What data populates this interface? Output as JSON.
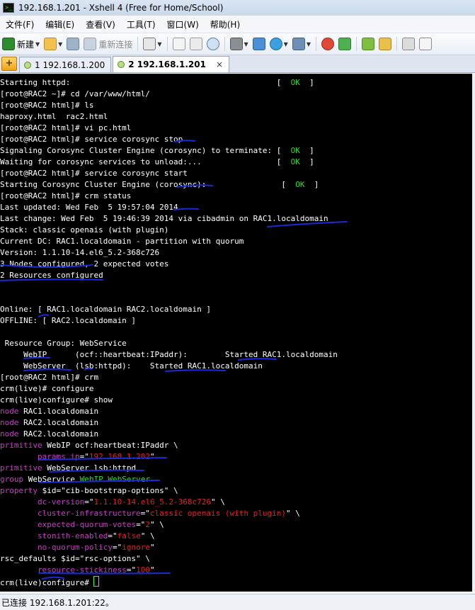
{
  "window": {
    "title": "192.168.1.201 - Xshell 4 (Free for Home/School)",
    "app_icon": "xshell-terminal-icon"
  },
  "menu": [
    "文件(F)",
    "编辑(E)",
    "查看(V)",
    "工具(T)",
    "窗口(W)",
    "帮助(H)"
  ],
  "toolbar": {
    "new_label": "新建",
    "reconnect_label": "重新连接",
    "icons": [
      "new-session-icon",
      "open-folder-icon",
      "link-icon",
      "reconnect-icon",
      "properties-icon",
      "copy-icon",
      "paste-icon",
      "find-icon",
      "print-icon",
      "transfer-icon",
      "globe-icon",
      "font-icon",
      "xftp-icon",
      "xagent-icon",
      "layout-icon",
      "lock-icon",
      "keyboard-icon",
      "chat-icon"
    ]
  },
  "tabs": [
    {
      "label": "1 192.168.1.200",
      "active": false
    },
    {
      "label": "2 192.168.1.201",
      "active": true
    }
  ],
  "terminal_lines": [
    [
      {
        "t": "Starting httpd:                                            [  "
      },
      {
        "t": "OK",
        "c": "green"
      },
      {
        "t": "  ]"
      }
    ],
    [
      {
        "t": "[root@RAC2 ~]# cd /var/www/html/"
      }
    ],
    [
      {
        "t": "[root@RAC2 html]# ls"
      }
    ],
    [
      {
        "t": "haproxy.html  rac2.html"
      }
    ],
    [
      {
        "t": "[root@RAC2 html]# vi pc.html"
      }
    ],
    [
      {
        "t": "[root@RAC2 html]# service corosync stop"
      }
    ],
    [
      {
        "t": "Signaling Corosync Cluster Engine (corosync) to terminate: [  "
      },
      {
        "t": "OK",
        "c": "green"
      },
      {
        "t": "  ]"
      }
    ],
    [
      {
        "t": "Waiting for corosync services to unload:...                [  "
      },
      {
        "t": "OK",
        "c": "green"
      },
      {
        "t": "  ]"
      }
    ],
    [
      {
        "t": "[root@RAC2 html]# service corosync start"
      }
    ],
    [
      {
        "t": "Starting Corosync Cluster Engine (corosync):                [  "
      },
      {
        "t": "OK",
        "c": "green"
      },
      {
        "t": "  ]"
      }
    ],
    [
      {
        "t": "[root@RAC2 html]# crm status"
      }
    ],
    [
      {
        "t": "Last updated: Wed Feb  5 19:57:04 2014"
      }
    ],
    [
      {
        "t": "Last change: Wed Feb  5 19:46:39 2014 via cibadmin on RAC1.localdomain"
      }
    ],
    [
      {
        "t": "Stack: classic openais (with plugin)"
      }
    ],
    [
      {
        "t": "Current DC: RAC1.localdomain - partition with quorum"
      }
    ],
    [
      {
        "t": "Version: 1.1.10-14.el6_5.2-368c726"
      }
    ],
    [
      {
        "t": "3 Nodes configured, 2 expected votes"
      }
    ],
    [
      {
        "t": "2 Resources configured"
      }
    ],
    [
      {
        "t": ""
      }
    ],
    [
      {
        "t": ""
      }
    ],
    [
      {
        "t": "Online: [ RAC1.localdomain RAC2.localdomain ]"
      }
    ],
    [
      {
        "t": "OFFLINE: [ RAC2.localdomain ]"
      }
    ],
    [
      {
        "t": ""
      }
    ],
    [
      {
        "t": " Resource Group: WebService"
      }
    ],
    [
      {
        "t": "     WebIP      (ocf::heartbeat:IPaddr):        Started RAC1.localdomain"
      }
    ],
    [
      {
        "t": "     WebServer  (lsb:httpd):    Started RAC1.localdomain"
      }
    ],
    [
      {
        "t": "[root@RAC2 html]# crm"
      }
    ],
    [
      {
        "t": "crm(live)# configure"
      }
    ],
    [
      {
        "t": "crm(live)configure# show"
      }
    ],
    [
      {
        "t": "node",
        "c": "purple"
      },
      {
        "t": " RAC1.localdomain"
      }
    ],
    [
      {
        "t": "node",
        "c": "purple"
      },
      {
        "t": " RAC2.localdomain"
      }
    ],
    [
      {
        "t": "node",
        "c": "purple"
      },
      {
        "t": " RAC2.localdomain"
      }
    ],
    [
      {
        "t": "primitive",
        "c": "purple"
      },
      {
        "t": " WebIP ocf:heartbeat:IPaddr \\"
      }
    ],
    [
      {
        "t": "        "
      },
      {
        "t": "params",
        "c": "purple"
      },
      {
        "t": " "
      },
      {
        "t": "ip",
        "c": "purple"
      },
      {
        "t": "=\""
      },
      {
        "t": "192.168.1.202",
        "c": "red"
      },
      {
        "t": "\""
      }
    ],
    [
      {
        "t": "primitive",
        "c": "purple"
      },
      {
        "t": " WebServer lsb:httpd"
      }
    ],
    [
      {
        "t": "group",
        "c": "purple"
      },
      {
        "t": " WebService "
      },
      {
        "t": "WebIP WebServer",
        "c": "green"
      }
    ],
    [
      {
        "t": "property",
        "c": "purple"
      },
      {
        "t": " $id=\"cib-bootstrap-options\" \\"
      }
    ],
    [
      {
        "t": "        "
      },
      {
        "t": "dc-version",
        "c": "purple"
      },
      {
        "t": "=\""
      },
      {
        "t": "1.1.10-14.el6_5.2-368c726",
        "c": "red"
      },
      {
        "t": "\" \\"
      }
    ],
    [
      {
        "t": "        "
      },
      {
        "t": "cluster-infrastructure",
        "c": "purple"
      },
      {
        "t": "=\""
      },
      {
        "t": "classic openais (with plugin)",
        "c": "red"
      },
      {
        "t": "\" \\"
      }
    ],
    [
      {
        "t": "        "
      },
      {
        "t": "expected-quorum-votes",
        "c": "purple"
      },
      {
        "t": "=\""
      },
      {
        "t": "2",
        "c": "red"
      },
      {
        "t": "\" \\"
      }
    ],
    [
      {
        "t": "        "
      },
      {
        "t": "stonith-enabled",
        "c": "purple"
      },
      {
        "t": "=\""
      },
      {
        "t": "false",
        "c": "red"
      },
      {
        "t": "\" \\"
      }
    ],
    [
      {
        "t": "        "
      },
      {
        "t": "no-quorum-policy",
        "c": "purple"
      },
      {
        "t": "=\""
      },
      {
        "t": "ignore",
        "c": "red"
      },
      {
        "t": "\""
      }
    ],
    [
      {
        "t": "rsc_defaults $id=\"rsc-options\" \\"
      }
    ],
    [
      {
        "t": "        "
      },
      {
        "t": "resource-stickiness",
        "c": "purple"
      },
      {
        "t": "=\""
      },
      {
        "t": "100",
        "c": "red"
      },
      {
        "t": "\""
      }
    ],
    [
      {
        "t": "crm(live)configure# "
      },
      {
        "cursor": true
      }
    ]
  ],
  "status_bar": {
    "text": "已连接 192.168.1.201:22。"
  },
  "colors": {
    "terminal_bg": "#000000",
    "terminal_fg": "#ffffff",
    "ok_green": "#33d633",
    "keyword_purple": "#c040c0",
    "value_red": "#e02020",
    "annotation_blue": "#1a2bd6"
  }
}
